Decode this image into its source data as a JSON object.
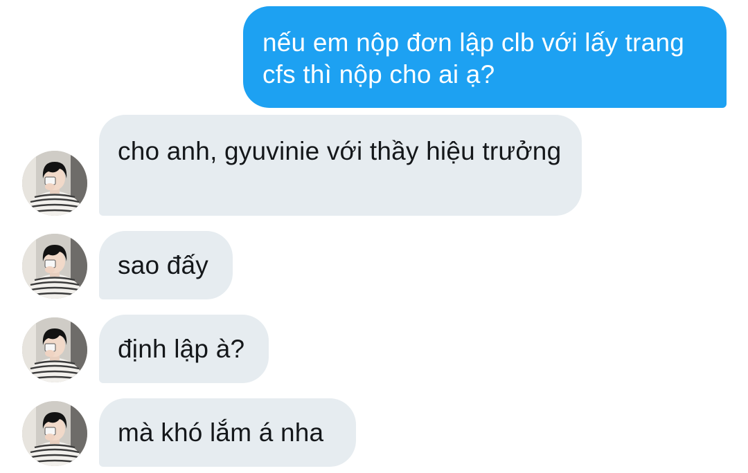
{
  "messages": [
    {
      "sender": "me",
      "text": "nếu em nộp đơn lập clb với lấy trang cfs thì nộp cho ai ạ?"
    },
    {
      "sender": "other",
      "text": "cho anh, gyuvinie với thầy hiệu trưởng"
    },
    {
      "sender": "other",
      "text": "sao đấy"
    },
    {
      "sender": "other",
      "text": "định lập à?"
    },
    {
      "sender": "other",
      "text": "mà khó lắm á nha"
    }
  ],
  "colors": {
    "outgoing_bubble": "#1da1f2",
    "incoming_bubble": "#e6ecf0",
    "outgoing_text": "#ffffff",
    "incoming_text": "#14171a"
  },
  "icons": {
    "avatar": "user-avatar-photo"
  }
}
